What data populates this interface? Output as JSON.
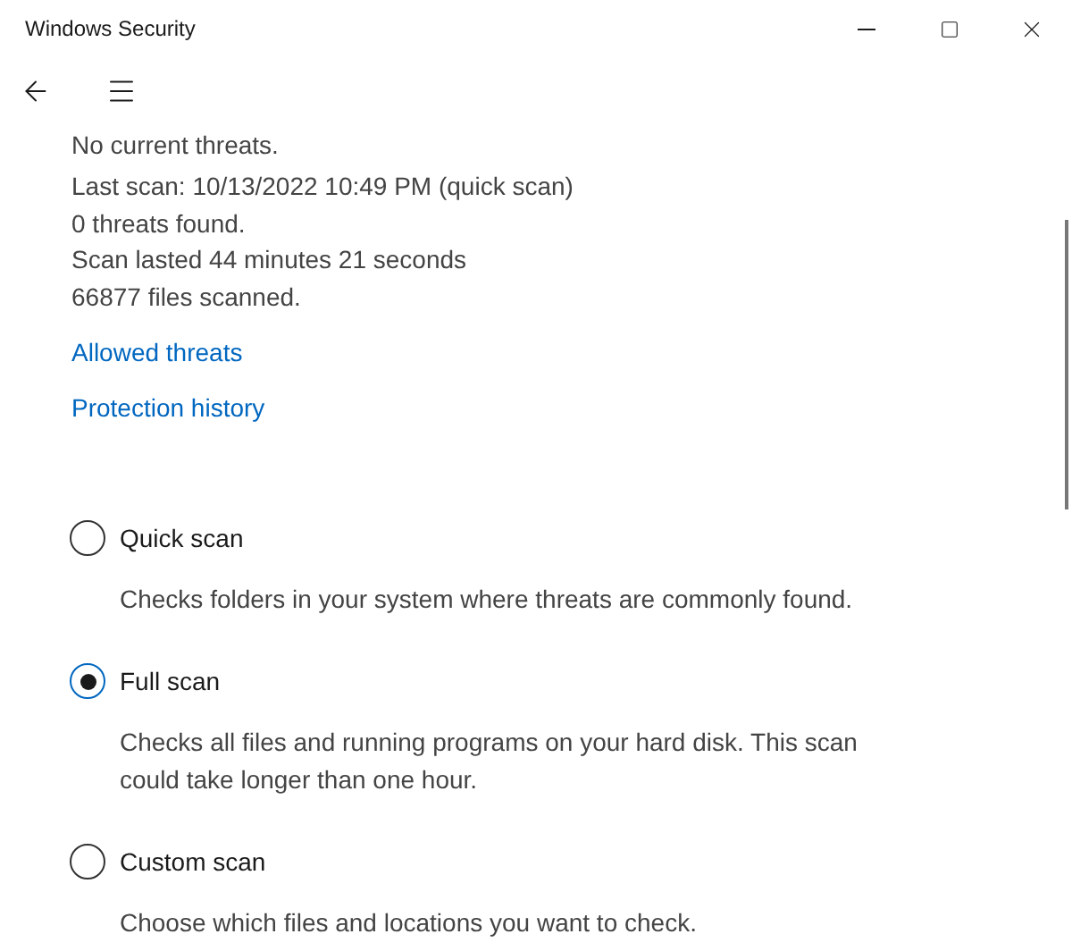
{
  "window": {
    "title": "Windows Security"
  },
  "status": {
    "headline": "No current threats.",
    "details": [
      "Last scan: 10/13/2022 10:49 PM (quick scan)",
      "0 threats found.",
      "Scan lasted 44 minutes 21 seconds",
      "66877 files scanned."
    ]
  },
  "links": [
    "Allowed threats",
    "Protection history"
  ],
  "scan_options": [
    {
      "label": "Quick scan",
      "selected": false,
      "description": "Checks folders in your system where threats are commonly found."
    },
    {
      "label": "Full scan",
      "selected": true,
      "description": "Checks all files and running programs on your hard disk. This scan could take longer than one hour."
    },
    {
      "label": "Custom scan",
      "selected": false,
      "description": "Choose which files and locations you want to check."
    }
  ]
}
